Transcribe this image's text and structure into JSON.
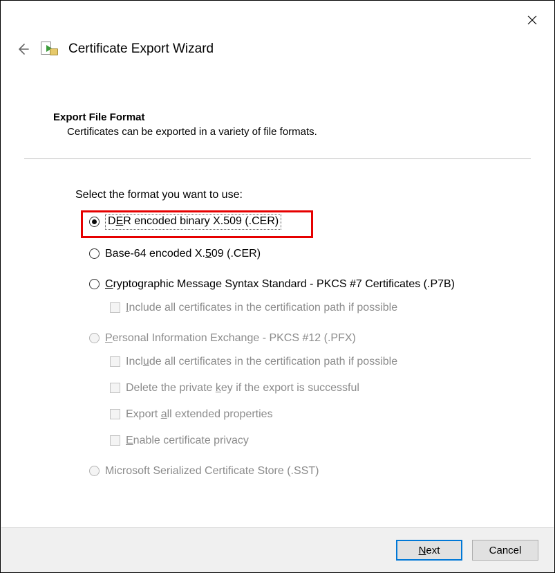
{
  "window": {
    "title": "Certificate Export Wizard"
  },
  "section": {
    "title": "Export File Format",
    "subtitle": "Certificates can be exported in a variety of file formats."
  },
  "prompt": "Select the format you want to use:",
  "options": {
    "der": {
      "pre": "D",
      "u": "E",
      "post": "R encoded binary X.509 (.CER)",
      "checked": true,
      "disabled": false
    },
    "base64": {
      "pre": "Base-64 encoded X.",
      "u": "5",
      "post": "09 (.CER)",
      "checked": false,
      "disabled": false
    },
    "pkcs7": {
      "pre": "",
      "u": "C",
      "post": "ryptographic Message Syntax Standard - PKCS #7 Certificates (.P7B)",
      "checked": false,
      "disabled": false,
      "sub": {
        "include7": {
          "pre": "",
          "u": "I",
          "post": "nclude all certificates in the certification path if possible",
          "disabled": true
        }
      }
    },
    "pfx": {
      "pre": "",
      "u": "P",
      "post": "ersonal Information Exchange - PKCS #12 (.PFX)",
      "checked": false,
      "disabled": true,
      "sub": {
        "include12": {
          "pre": "Incl",
          "u": "u",
          "post": "de all certificates in the certification path if possible",
          "disabled": true
        },
        "delete": {
          "pre": "Delete the private ",
          "u": "k",
          "post": "ey if the export is successful",
          "disabled": true
        },
        "extended": {
          "pre": "Export ",
          "u": "a",
          "post": "ll extended properties",
          "disabled": true
        },
        "privacy": {
          "pre": "",
          "u": "E",
          "post": "nable certificate privacy",
          "disabled": true
        }
      }
    },
    "sst": {
      "plain": "Microsoft Serialized Certificate Store (.SST)",
      "checked": false,
      "disabled": true
    }
  },
  "footer": {
    "next": {
      "u": "N",
      "post": "ext"
    },
    "cancel": "Cancel"
  }
}
